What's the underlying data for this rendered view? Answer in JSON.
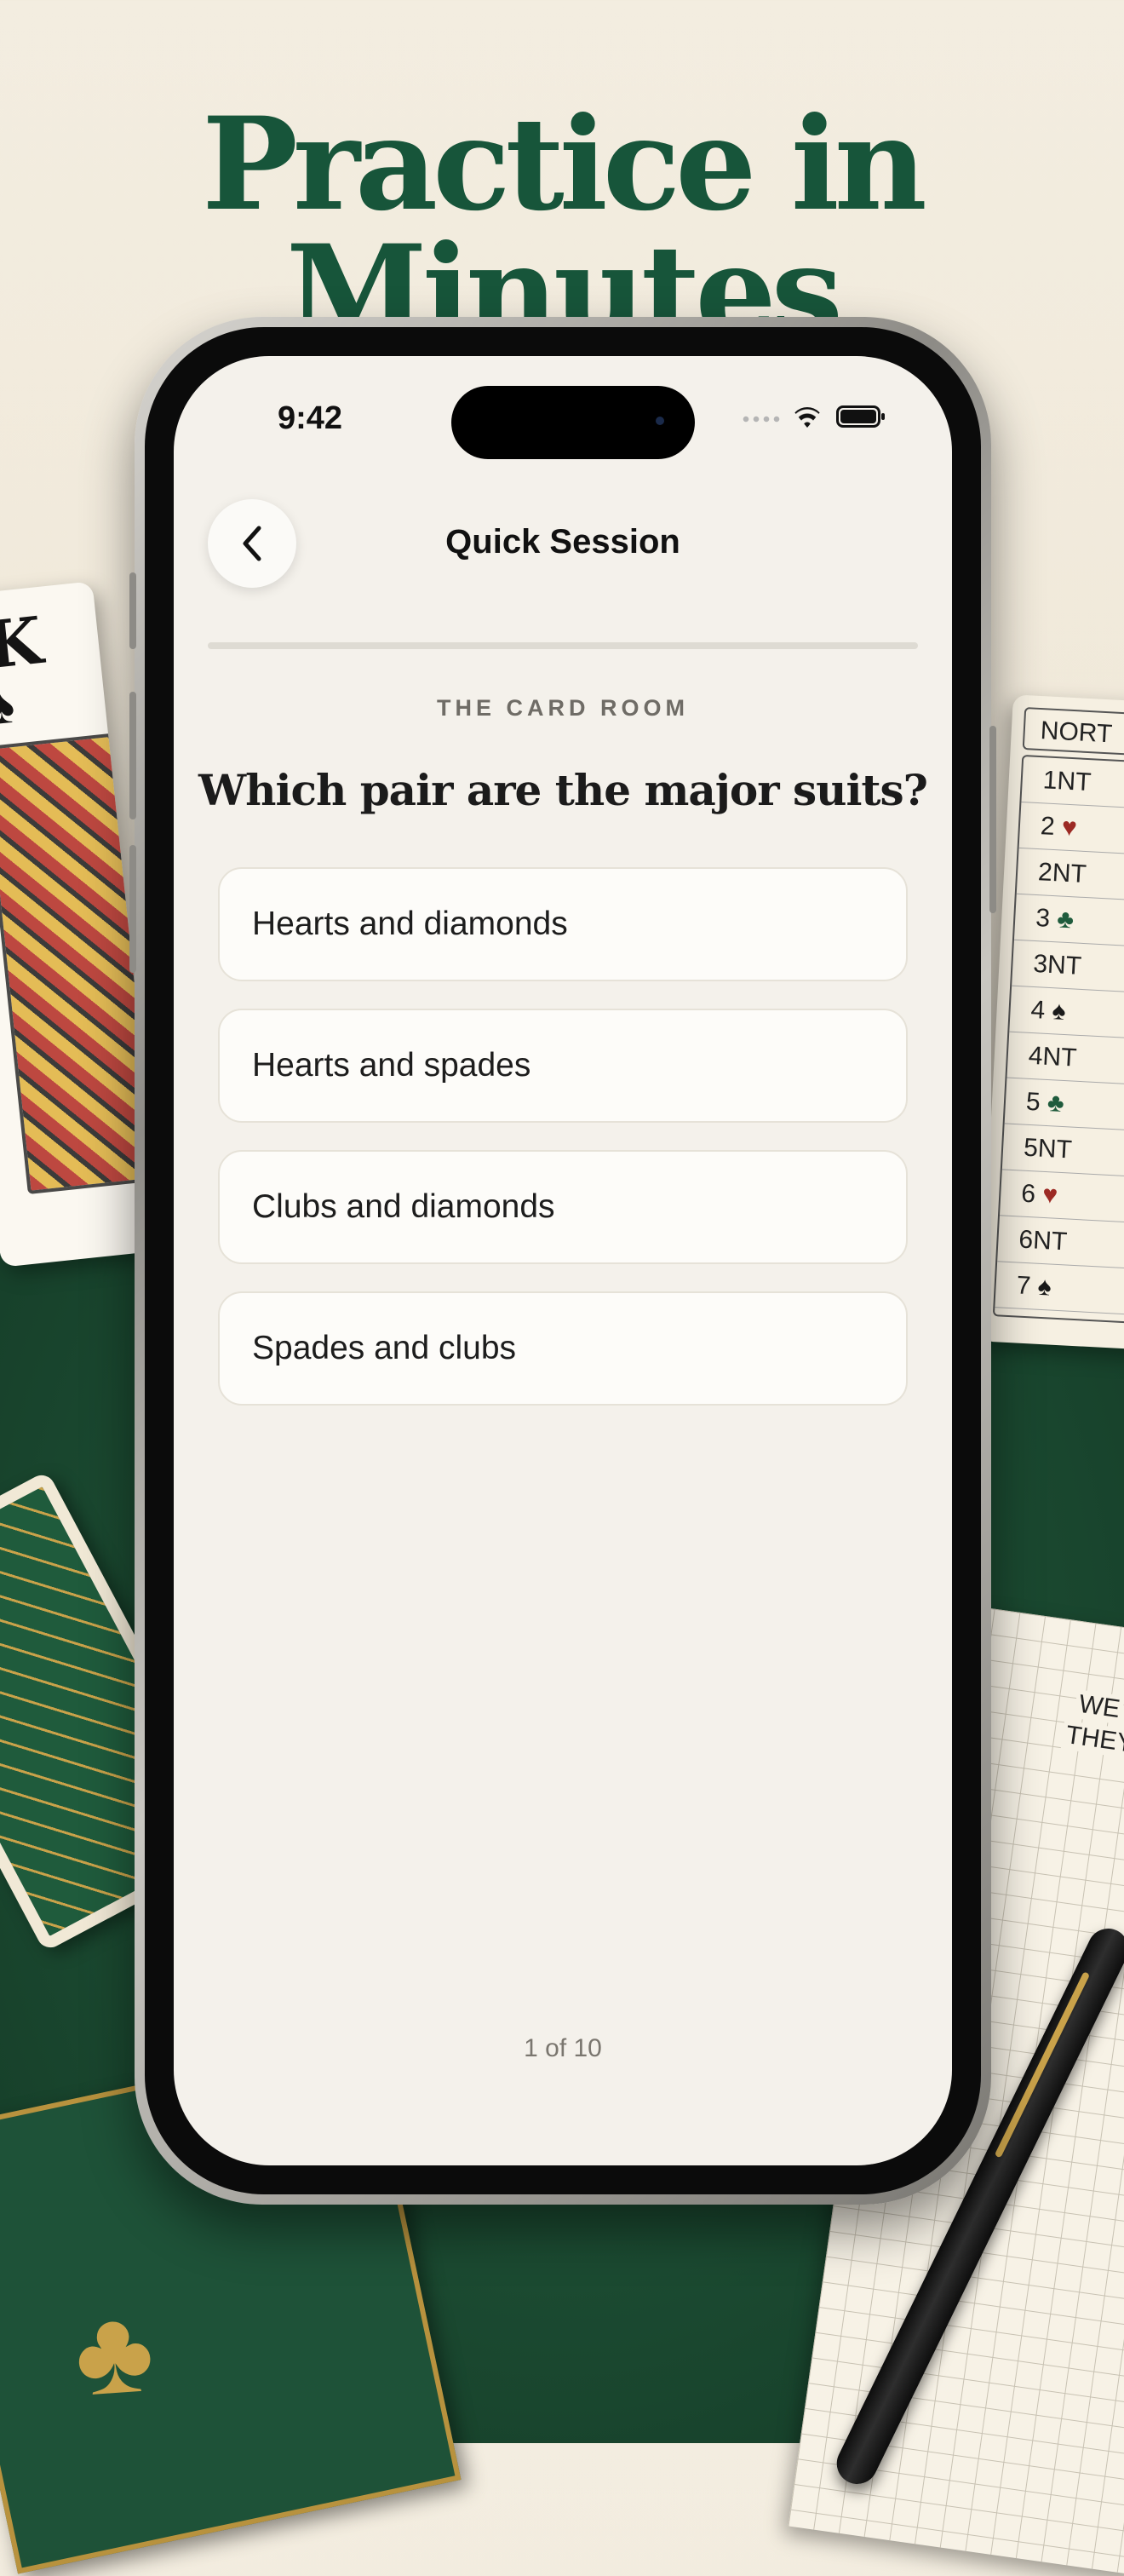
{
  "headline": "Practice in Minutes",
  "decor": {
    "king_card_rank": "K",
    "king_card_suit": "♠",
    "bid_card_header": "NORT",
    "bids": [
      {
        "level": "1NT",
        "suit": "",
        "color": ""
      },
      {
        "level": "2",
        "suit": "♥",
        "color": "red"
      },
      {
        "level": "2NT",
        "suit": "",
        "color": ""
      },
      {
        "level": "3",
        "suit": "♣",
        "color": "green"
      },
      {
        "level": "3NT",
        "suit": "",
        "color": ""
      },
      {
        "level": "4",
        "suit": "♠",
        "color": "black"
      },
      {
        "level": "4NT",
        "suit": "",
        "color": ""
      },
      {
        "level": "5",
        "suit": "♣",
        "color": "green"
      },
      {
        "level": "5NT",
        "suit": "",
        "color": ""
      },
      {
        "level": "6",
        "suit": "♥",
        "color": "red"
      },
      {
        "level": "6NT",
        "suit": "",
        "color": ""
      },
      {
        "level": "7",
        "suit": "♠",
        "color": "black"
      }
    ],
    "score_we": "WE",
    "score_they": "THEY",
    "club_emblem": "♣"
  },
  "status_bar": {
    "time": "9:42"
  },
  "nav": {
    "back_icon": "chevron-left-icon",
    "title": "Quick Session"
  },
  "progress": {
    "value": 0.0
  },
  "quiz": {
    "eyebrow": "THE CARD ROOM",
    "question": "Which pair are the major suits?",
    "options": [
      "Hearts and diamonds",
      "Hearts and spades",
      "Clubs and diamonds",
      "Spades and clubs"
    ],
    "counter": "1 of 10"
  },
  "colors": {
    "brand_green": "#17553a",
    "accent_gold": "#c9a24a",
    "screen_bg": "#f4f1eb"
  }
}
